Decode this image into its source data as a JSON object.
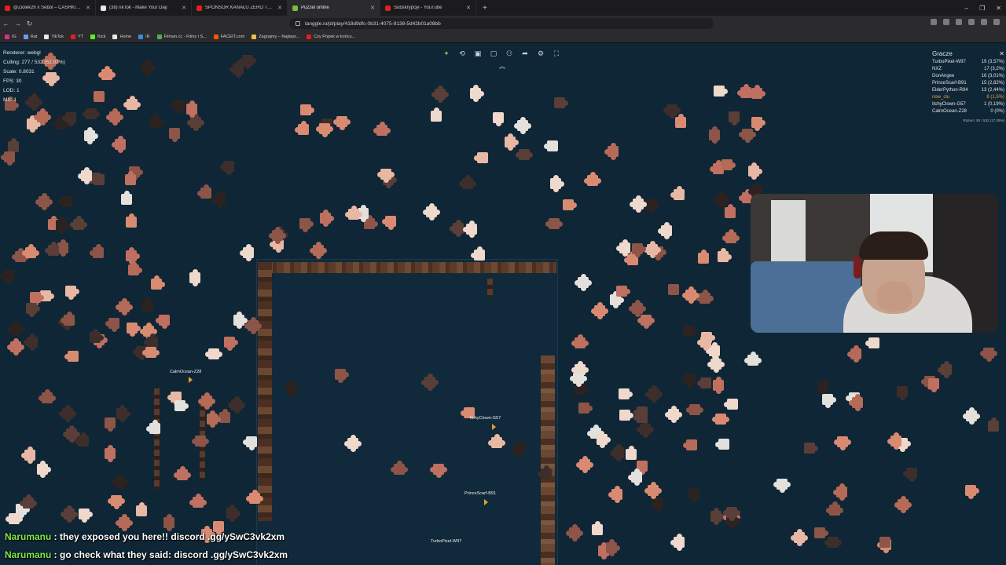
{
  "browser": {
    "tabs": [
      {
        "label": "@Ziolek2h x Sebol – CASHKIET [LIVE",
        "color": "#e02020"
      },
      {
        "label": "(38)TikTok - Make Your Day",
        "color": "#e8e8e8"
      },
      {
        "label": "SPONSOR KANAŁU ZERO TO PR...",
        "color": "#e02020"
      },
      {
        "label": "Puzzel online",
        "color": "#7dbb3c",
        "active": true
      },
      {
        "label": "Subskrypcje - YouTube",
        "color": "#e02020"
      }
    ],
    "new_tab": "+",
    "window_controls": {
      "minimize": "–",
      "maximize": "❐",
      "close": "✕"
    },
    "url": "tanggle.io/pl/play/418d9dfc-0b31-4075-9138-5d42b01a08bb",
    "bookmarks": [
      {
        "label": "IG",
        "color": "#d63384"
      },
      {
        "label": "Rat",
        "color": "#6a9cf0"
      },
      {
        "label": "TikTok",
        "color": "#e8e8e8"
      },
      {
        "label": "YT",
        "color": "#e02020"
      },
      {
        "label": "Kick",
        "color": "#53fc18"
      },
      {
        "label": "Home",
        "color": "#e8e8e8"
      },
      {
        "label": "!R",
        "color": "#3d8bd9"
      },
      {
        "label": "Filman.cc - Filmy i S...",
        "color": "#4caf50"
      },
      {
        "label": "FACEIT.com",
        "color": "#ff5500"
      },
      {
        "label": "Zagrajmy – Najleps...",
        "color": "#f0c040"
      },
      {
        "label": "Czy Popek w końcu...",
        "color": "#e02020"
      }
    ]
  },
  "hud": {
    "renderer": "Renderer: webgl",
    "culling": "Culling: 277 / 532 (52.07%)",
    "scale": "Scale: 0.8031",
    "fps": "FPS: 30",
    "lod": "LOD: 1",
    "ms": "MS: 1"
  },
  "toolbar": {
    "icons": [
      "puzzle-icon",
      "image-icon",
      "preview-icon",
      "box-icon",
      "users-icon",
      "share-icon",
      "settings-icon",
      "fullscreen-icon"
    ],
    "glyphs": [
      "✦",
      "⟲",
      "▣",
      "▢",
      "⚇",
      "➦",
      "⚙",
      "⛶"
    ],
    "collapse_glyph": "︽"
  },
  "players": {
    "title": "Gracze",
    "close": "✕",
    "list": [
      {
        "name": "TurboPixel-W97",
        "score": "19 (3,57%)",
        "color": "#e2e2e2"
      },
      {
        "name": "NXZ",
        "score": "17 (3,2%)",
        "color": "#e2e2e2"
      },
      {
        "name": "DonAngee",
        "score": "16 (3,01%)",
        "color": "#e2e2e2"
      },
      {
        "name": "PrinceScarf-B91",
        "score": "15 (2,82%)",
        "color": "#e2e2e2"
      },
      {
        "name": "ElderPython-R94",
        "score": "13 (2,44%)",
        "color": "#e2e2e2"
      },
      {
        "name": "now_clu",
        "score": "8 (1,5%)",
        "color": "#e8a33a"
      },
      {
        "name": "ItchyClown-G57",
        "score": "1 (0,19%)",
        "color": "#e2e2e2"
      },
      {
        "name": "CalmOcean-Z28",
        "score": "0 (0%)",
        "color": "#e2e2e2"
      }
    ],
    "total": "Razem: 92 / 532 (17,29%)"
  },
  "cursors": [
    {
      "name": "CalmOcean-Z28"
    },
    {
      "name": "ItchyClown-G57"
    },
    {
      "name": "PrinceScarf-B91"
    },
    {
      "name": "TurboPixel-W97"
    }
  ],
  "chat": [
    {
      "nick": "Narumanu",
      "text": " : they exposed you here!! discord .gg/ySwC3vk2xm"
    },
    {
      "nick": "Narumanu",
      "text": " : go check what they said: discord .gg/ySwC3vk2xm"
    }
  ]
}
